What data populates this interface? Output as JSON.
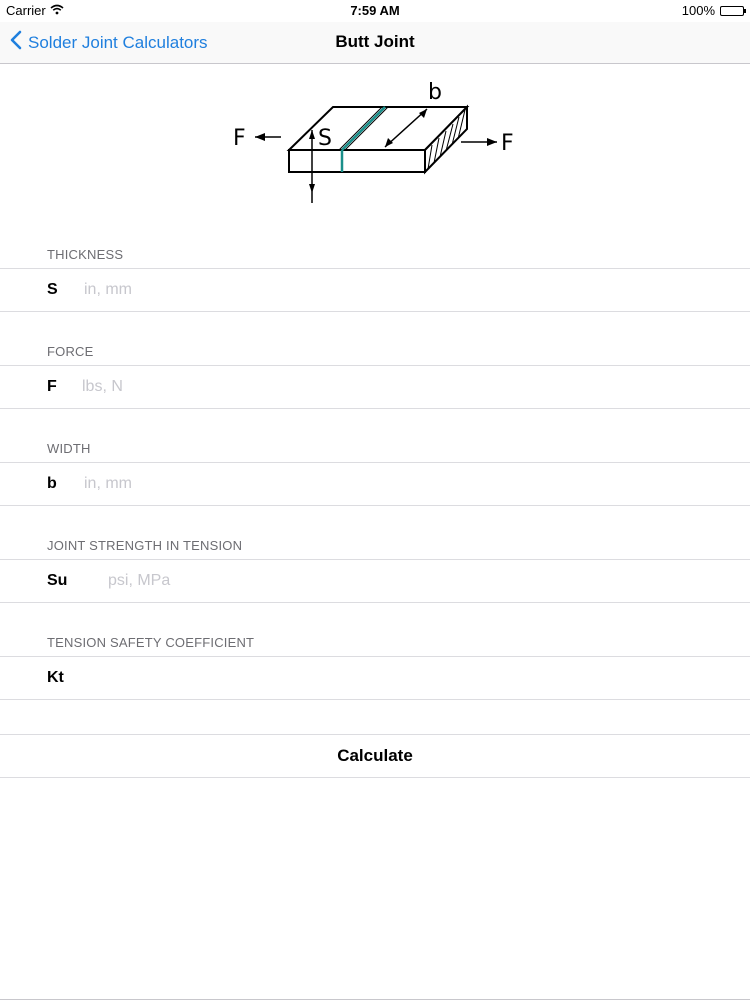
{
  "status_bar": {
    "carrier": "Carrier",
    "time": "7:59 AM",
    "battery": "100%"
  },
  "nav": {
    "back_label": "Solder Joint Calculators",
    "title": "Butt Joint"
  },
  "diagram": {
    "label_force_left": "F",
    "label_force_right": "F",
    "label_thickness": "S",
    "label_width": "b"
  },
  "form": {
    "sections": [
      {
        "header": "THICKNESS",
        "label": "S",
        "placeholder": "in, mm",
        "value": ""
      },
      {
        "header": "FORCE",
        "label": "F",
        "placeholder": "lbs, N",
        "value": ""
      },
      {
        "header": "WIDTH",
        "label": "b",
        "placeholder": "in, mm",
        "value": ""
      },
      {
        "header": "JOINT STRENGTH IN TENSION",
        "label": "Su",
        "placeholder": "psi, MPa",
        "value": ""
      },
      {
        "header": "TENSION SAFETY COEFFICIENT",
        "label": "Kt",
        "placeholder": "",
        "value": ""
      }
    ],
    "calculate_label": "Calculate"
  },
  "colors": {
    "accent": "#1f7fde",
    "solder_line": "#1a8f8a"
  }
}
